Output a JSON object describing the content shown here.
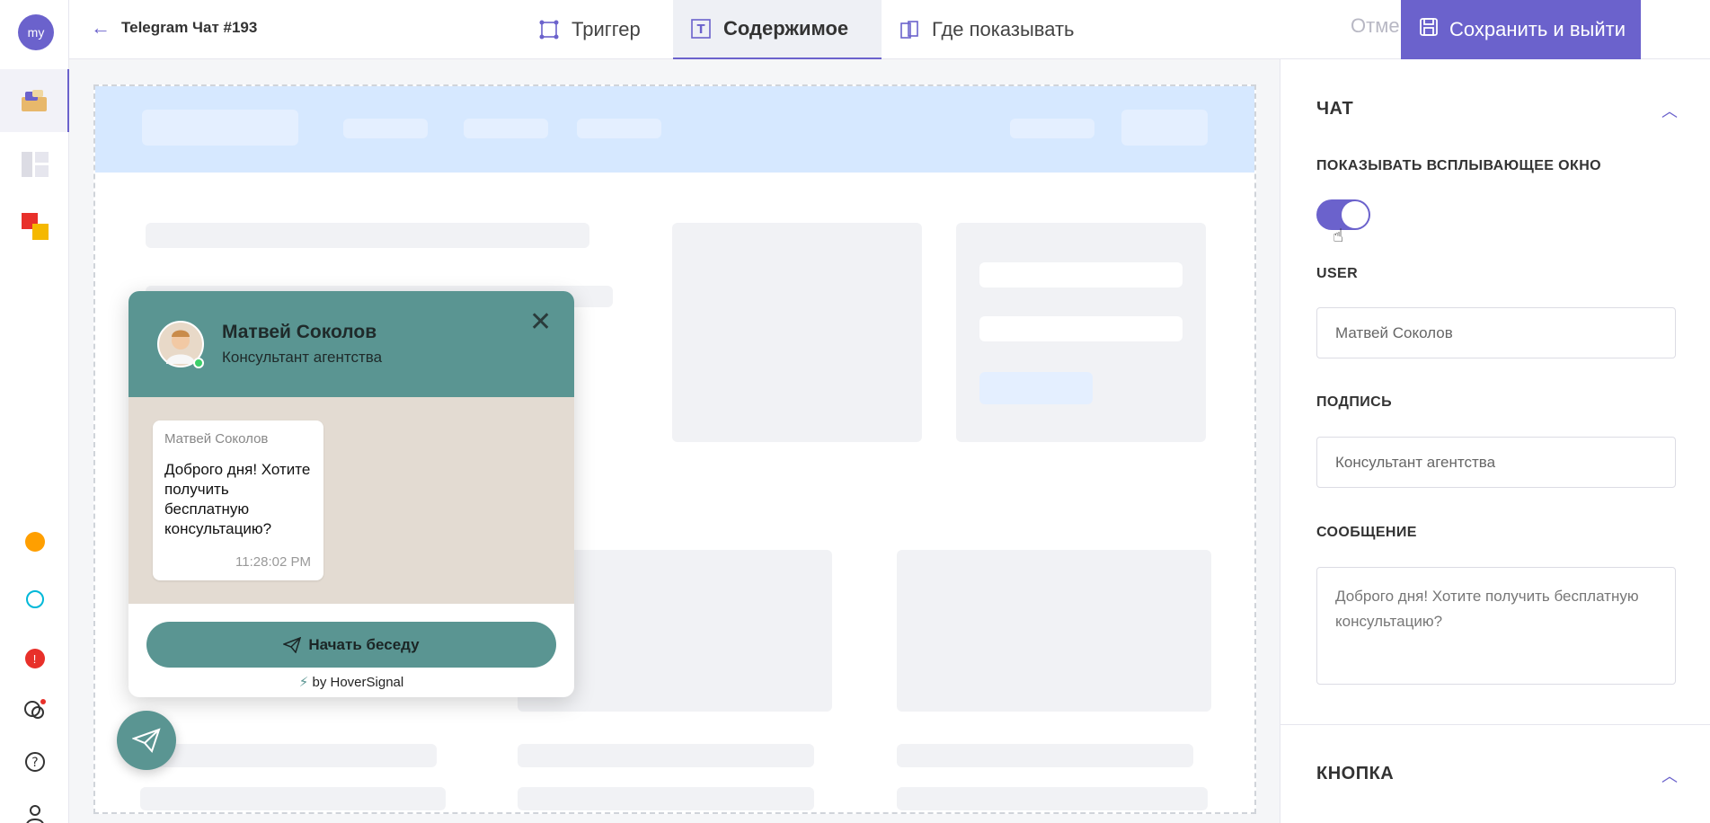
{
  "rail": {
    "avatar_text": "my",
    "icons": [
      "app-icon-active",
      "template-icon",
      "brand-icon",
      "status-dot-orange",
      "status-dot-cyan",
      "alert-icon",
      "chat-icon",
      "help-icon",
      "user-icon"
    ]
  },
  "topbar": {
    "title": "Telegram Чат #193",
    "tabs": [
      {
        "label": "Триггер"
      },
      {
        "label": "Содержимое"
      },
      {
        "label": "Где показывать"
      }
    ],
    "cancel_label": "Отменить",
    "save_label": "Сохранить и выйти"
  },
  "widget": {
    "name": "Матвей Соколов",
    "subtitle": "Консультант агентства",
    "message_author": "Матвей Соколов",
    "message_text": "Доброго дня! Хотите получить бесплатную консультацию?",
    "message_time": "11:28:02 PM",
    "button_label": "Начать беседу",
    "by_label": "by HoverSignal"
  },
  "panel": {
    "chat_section_title": "ЧАТ",
    "show_popup_label": "ПОКАЗЫВАТЬ ВСПЛЫВАЮЩЕЕ ОКНО",
    "show_popup_enabled": true,
    "user_label": "USER",
    "user_value": "Матвей Соколов",
    "signature_label": "ПОДПИСЬ",
    "signature_value": "Консультант агентства",
    "message_label": "СООБЩЕНИЕ",
    "message_value": "Доброго дня! Хотите получить бесплатную консультацию?",
    "button_section_title": "КНОПКА"
  },
  "colors": {
    "accent": "#6b62cc",
    "widget_teal": "#5a9592"
  }
}
